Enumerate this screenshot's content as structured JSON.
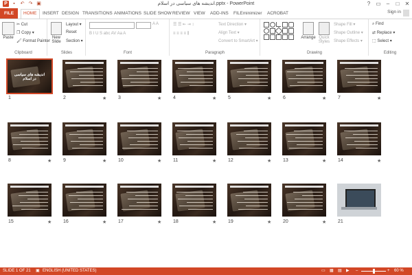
{
  "app": {
    "title": "اندیشه های سیاسی در اسلام.pptx - PowerPoint",
    "quick_access": [
      "save-icon",
      "undo-icon",
      "redo-icon",
      "start-slideshow-icon"
    ]
  },
  "window_controls": [
    "?",
    "▭",
    "–",
    "□",
    "✕"
  ],
  "tabs": [
    "FILE",
    "HOME",
    "INSERT",
    "DESIGN",
    "TRANSITIONS",
    "ANIMATIONS",
    "SLIDE SHOW",
    "REVIEW",
    "VIEW",
    "ADD-INS",
    "FILEminimizer",
    "ACROBAT"
  ],
  "active_tab": "HOME",
  "sign_in": "Sign in",
  "ribbon": {
    "clipboard": {
      "label": "Clipboard",
      "paste": "Paste",
      "cut": "Cut",
      "copy": "Copy",
      "format_painter": "Format Painter"
    },
    "slides": {
      "label": "Slides",
      "new_slide": "New Slide",
      "layout": "Layout",
      "reset": "Reset",
      "section": "Section"
    },
    "font": {
      "label": "Font"
    },
    "paragraph": {
      "label": "Paragraph",
      "text_direction": "Text Direction",
      "align_text": "Align Text",
      "convert_smartart": "Convert to SmartArt"
    },
    "drawing": {
      "label": "Drawing",
      "arrange": "Arrange",
      "quick_styles": "Quick Styles",
      "shape_fill": "Shape Fill",
      "shape_outline": "Shape Outline",
      "shape_effects": "Shape Effects"
    },
    "editing": {
      "label": "Editing",
      "find": "Find",
      "replace": "Replace",
      "select": "Select"
    }
  },
  "slides": [
    {
      "number": "1",
      "title": "اندیشه های سیاسی در اسلام",
      "star": ""
    },
    {
      "number": "2",
      "star": "★"
    },
    {
      "number": "3",
      "star": "★"
    },
    {
      "number": "4",
      "star": "★"
    },
    {
      "number": "5",
      "star": "★"
    },
    {
      "number": "6",
      "star": "★"
    },
    {
      "number": "7",
      "star": "★"
    },
    {
      "number": "8",
      "star": "★"
    },
    {
      "number": "9",
      "star": "★"
    },
    {
      "number": "10",
      "star": "★"
    },
    {
      "number": "11",
      "star": "★"
    },
    {
      "number": "12",
      "star": "★"
    },
    {
      "number": "13",
      "star": "★"
    },
    {
      "number": "14",
      "star": "★"
    },
    {
      "number": "15",
      "star": "★"
    },
    {
      "number": "16",
      "star": "★"
    },
    {
      "number": "17",
      "star": "★"
    },
    {
      "number": "18",
      "star": "★"
    },
    {
      "number": "19",
      "star": "★"
    },
    {
      "number": "20",
      "star": "★"
    },
    {
      "number": "21",
      "star": ""
    }
  ],
  "status": {
    "slide_info": "SLIDE 1 OF 21",
    "language": "ENGLISH (UNITED STATES)",
    "zoom": "60 %"
  },
  "colors": {
    "accent": "#d24726",
    "ribbon_border": "#d5d5d5"
  }
}
